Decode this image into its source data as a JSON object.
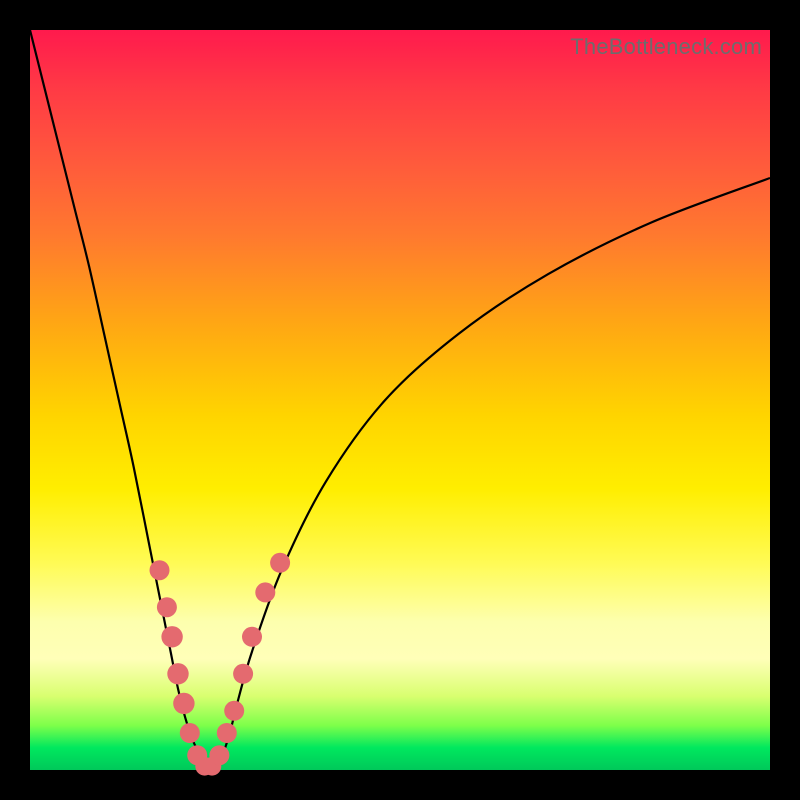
{
  "watermark": "TheBottleneck.com",
  "colors": {
    "frame": "#000000",
    "curve": "#000000",
    "marker": "#e46a6f"
  },
  "chart_data": {
    "type": "line",
    "title": "",
    "xlabel": "",
    "ylabel": "",
    "xlim": [
      0,
      100
    ],
    "ylim": [
      0,
      100
    ],
    "series": [
      {
        "name": "bottleneck-curve",
        "x": [
          0,
          2,
          4,
          6,
          8,
          10,
          12,
          14,
          16,
          18,
          19,
          20,
          21,
          22,
          23,
          24,
          25,
          26,
          27,
          28,
          30,
          34,
          40,
          48,
          58,
          70,
          84,
          100
        ],
        "y": [
          100,
          92,
          84,
          76,
          68,
          59,
          50,
          41,
          31,
          21,
          16,
          11,
          7,
          4,
          2,
          0,
          0,
          2,
          5,
          9,
          16,
          27,
          39,
          50,
          59,
          67,
          74,
          80
        ]
      }
    ],
    "markers": {
      "name": "highlighted-points",
      "points": [
        {
          "x": 17.5,
          "y": 27,
          "r": 1.5
        },
        {
          "x": 18.5,
          "y": 22,
          "r": 1.5
        },
        {
          "x": 19.2,
          "y": 18,
          "r": 1.6
        },
        {
          "x": 20.0,
          "y": 13,
          "r": 1.6
        },
        {
          "x": 20.8,
          "y": 9,
          "r": 1.6
        },
        {
          "x": 21.6,
          "y": 5,
          "r": 1.5
        },
        {
          "x": 22.6,
          "y": 2,
          "r": 1.5
        },
        {
          "x": 23.6,
          "y": 0.5,
          "r": 1.4
        },
        {
          "x": 24.6,
          "y": 0.5,
          "r": 1.4
        },
        {
          "x": 25.6,
          "y": 2,
          "r": 1.5
        },
        {
          "x": 26.6,
          "y": 5,
          "r": 1.5
        },
        {
          "x": 27.6,
          "y": 8,
          "r": 1.5
        },
        {
          "x": 28.8,
          "y": 13,
          "r": 1.5
        },
        {
          "x": 30.0,
          "y": 18,
          "r": 1.5
        },
        {
          "x": 31.8,
          "y": 24,
          "r": 1.5
        },
        {
          "x": 33.8,
          "y": 28,
          "r": 1.5
        }
      ]
    }
  }
}
